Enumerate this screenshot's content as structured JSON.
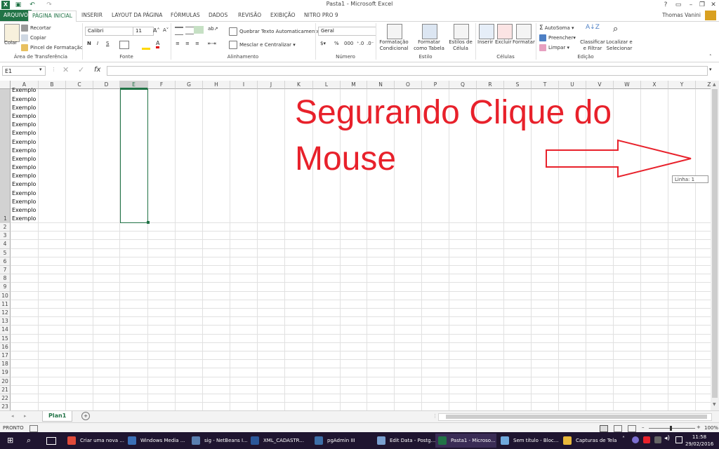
{
  "window": {
    "title": "Pasta1 - Microsoft Excel",
    "user": "Thomas Vanini"
  },
  "tabs": [
    "ARQUIVO",
    "PÁGINA INICIAL",
    "INSERIR",
    "LAYOUT DA PÁGINA",
    "FÓRMULAS",
    "DADOS",
    "REVISÃO",
    "EXIBIÇÃO",
    "NITRO PRO 9"
  ],
  "ribbon": {
    "clipboard": {
      "paste": "Colar",
      "cut": "Recortar",
      "copy": "Copiar",
      "format_painter": "Pincel de Formatação",
      "label": "Área de Transferência"
    },
    "font": {
      "name": "Calibri",
      "size": "11",
      "bold": "N",
      "italic": "I",
      "underline": "S",
      "label": "Fonte"
    },
    "alignment": {
      "wrap": "Quebrar Texto Automaticamente",
      "merge": "Mesclar e Centralizar",
      "label": "Alinhamento"
    },
    "number": {
      "format": "Geral",
      "label": "Número"
    },
    "styles": {
      "conditional": "Formatação Condicional",
      "table": "Formatar como Tabela",
      "cell": "Estilos de Célula",
      "label": "Estilo"
    },
    "cells": {
      "insert": "Inserir",
      "delete": "Excluir",
      "format": "Formatar",
      "label": "Células"
    },
    "editing": {
      "autosum": "AutoSoma",
      "fill": "Preencher",
      "clear": "Limpar",
      "sort": "Classificar e Filtrar",
      "find": "Localizar e Selecionar",
      "label": "Edição"
    }
  },
  "formula_bar": {
    "name_box": "E1",
    "fx": "fx",
    "value": ""
  },
  "columns": [
    "A",
    "B",
    "C",
    "D",
    "E",
    "F",
    "G",
    "H",
    "I",
    "J",
    "K",
    "L",
    "M",
    "N",
    "O",
    "P",
    "Q",
    "R",
    "S",
    "T",
    "U",
    "V",
    "W",
    "X",
    "Y",
    "Z"
  ],
  "cell_text": "Exemplo",
  "rows_visible": [
    "1",
    "2",
    "3",
    "4",
    "5",
    "6",
    "7",
    "8",
    "9",
    "10",
    "11",
    "12",
    "13",
    "14",
    "15",
    "16",
    "17",
    "18",
    "19",
    "20",
    "21",
    "22",
    "23"
  ],
  "annotation": {
    "line1": "Segurando Clique do",
    "line2": "Mouse"
  },
  "tooltip": "Linha: 1",
  "sheet": {
    "tab": "Plan1"
  },
  "status": {
    "mode": "PRONTO",
    "zoom": "100%"
  },
  "taskbar": {
    "items": [
      "Criar uma nova ...",
      "Windows Media ...",
      "sig - NetBeans I...",
      "XML_CADASTR...",
      "pgAdmin III",
      "Edit Data - Postg...",
      "Pasta1 - Microso...",
      "Sem título - Bloc...",
      "Capturas de Tela"
    ],
    "time": "11:58",
    "date": "29/02/2016"
  },
  "colors": {
    "accent": "#217346",
    "annotation": "#e8212b"
  }
}
